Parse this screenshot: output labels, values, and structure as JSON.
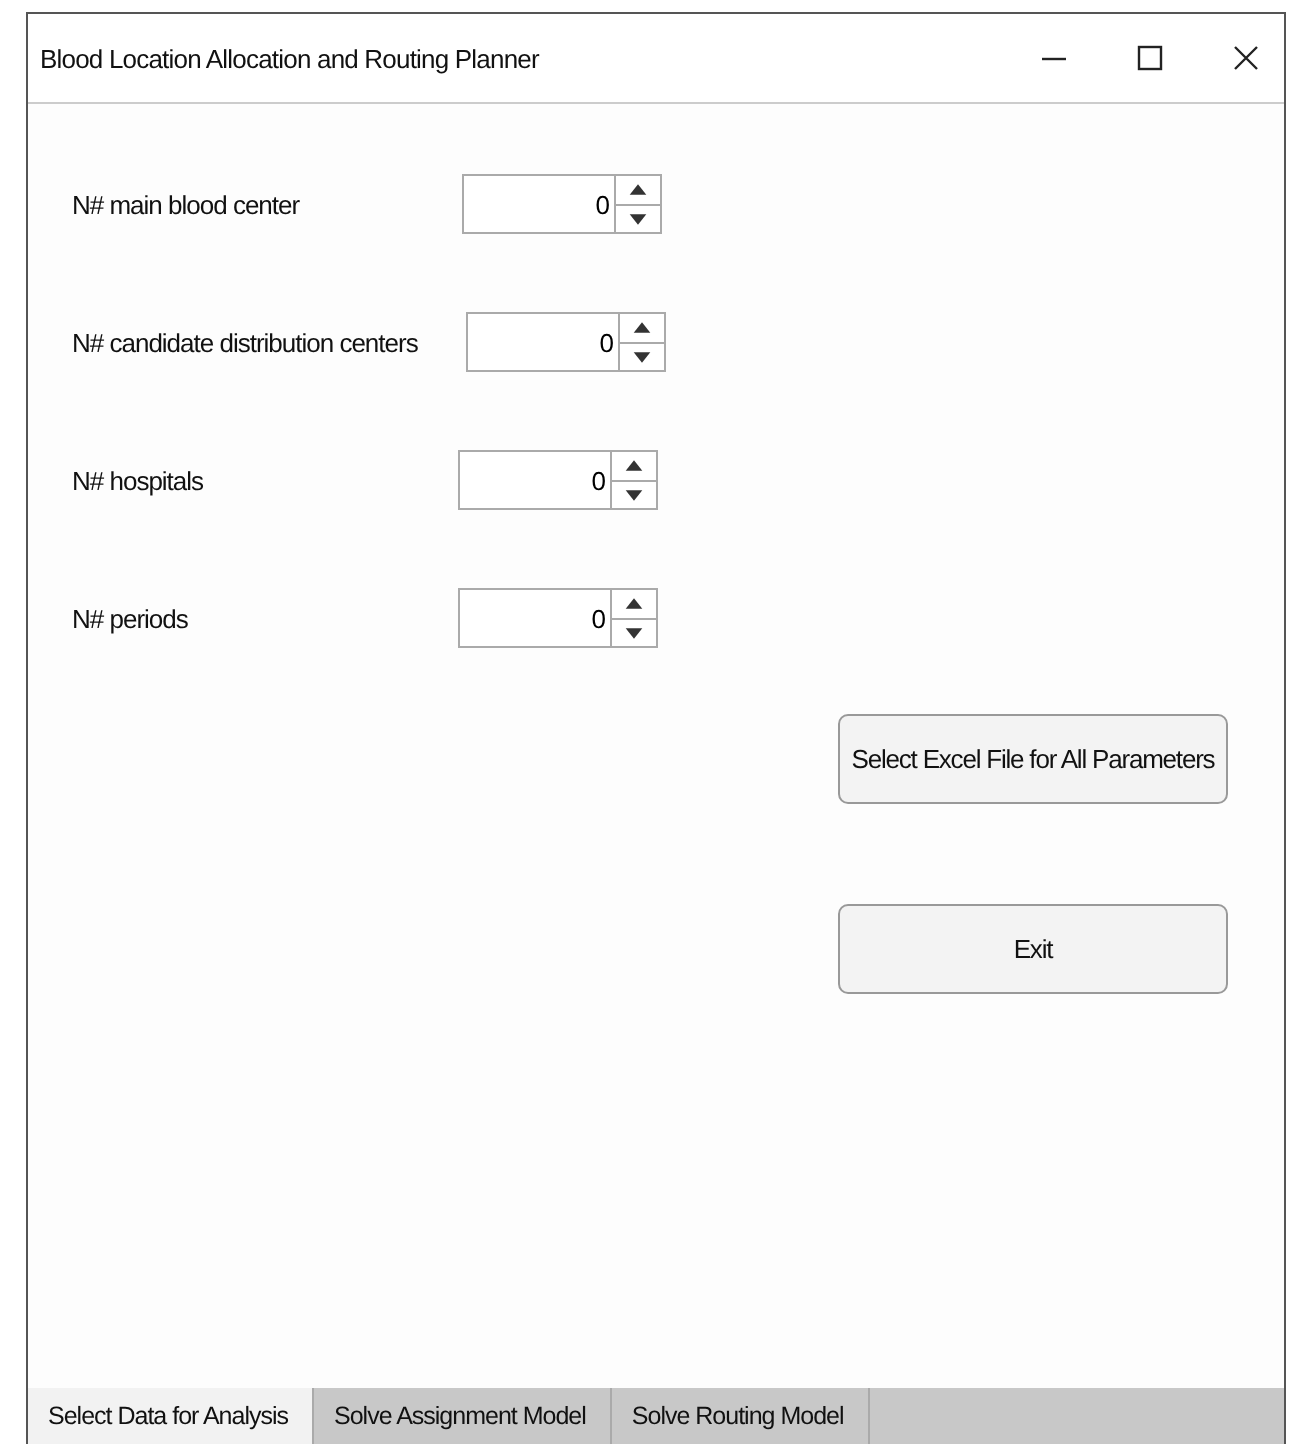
{
  "window": {
    "title": "Blood Location Allocation and Routing Planner"
  },
  "fields": [
    {
      "label": "N# main blood center",
      "value": "0"
    },
    {
      "label": "N# candidate distribution centers",
      "value": "0"
    },
    {
      "label": "N# hospitals",
      "value": "0"
    },
    {
      "label": "N# periods",
      "value": "0"
    }
  ],
  "buttons": [
    "Select Excel File for All Parameters",
    "Exit"
  ],
  "tabs": [
    {
      "label": "Select Data for Analysis",
      "selected": true
    },
    {
      "label": "Solve Assignment Model",
      "selected": false
    },
    {
      "label": "Solve Routing Model",
      "selected": false
    }
  ]
}
